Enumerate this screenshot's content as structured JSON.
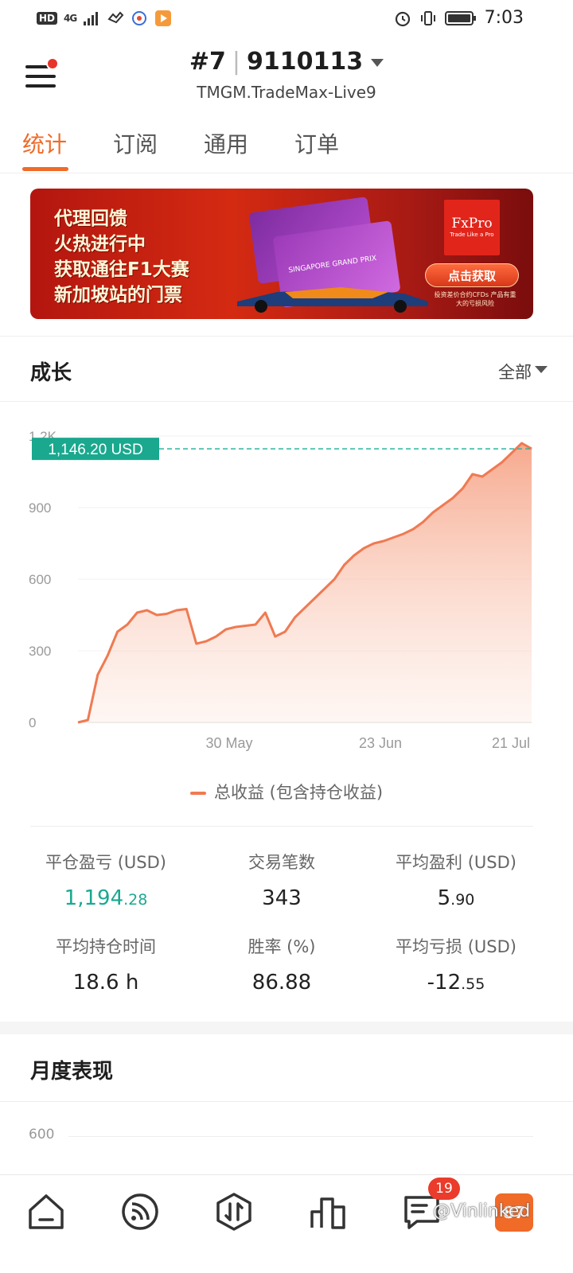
{
  "status_bar": {
    "hd": "HD",
    "signal": "4G",
    "time": "7:03"
  },
  "header": {
    "account_prefix": "#7",
    "account_number": "9110113",
    "server": "TMGM.TradeMax-Live9"
  },
  "tabs": [
    {
      "label": "统计",
      "active": true
    },
    {
      "label": "订阅",
      "active": false
    },
    {
      "label": "通用",
      "active": false
    },
    {
      "label": "订单",
      "active": false
    }
  ],
  "banner": {
    "lines": [
      "代理回馈",
      "火热进行中",
      "获取通往F1大赛",
      "新加坡站的门票"
    ],
    "brand": "FxPro",
    "brand_tagline": "Trade Like a Pro",
    "card_text": "SINGAPORE GRAND PRIX",
    "button": "点击获取",
    "risk_note": "投资差价合约CFDs 产品有重大的亏损风险"
  },
  "growth": {
    "title": "成长",
    "filter": "全部",
    "current_value_label": "1,146.20 USD",
    "legend": "总收益 (包含持仓收益)"
  },
  "chart_data": {
    "type": "area",
    "y_ticks": [
      "0",
      "300",
      "600",
      "900",
      "1.2K"
    ],
    "x_ticks": [
      "30 May",
      "23 Jun",
      "21 Jul"
    ],
    "ylim": [
      0,
      1200
    ],
    "current_value": 1146.2,
    "grid": true,
    "series": [
      {
        "values": [
          0,
          10,
          200,
          280,
          380,
          410,
          460,
          470,
          450,
          455,
          470,
          475,
          330,
          340,
          360,
          390,
          400,
          405,
          410,
          460,
          360,
          380,
          440,
          480,
          520,
          560,
          600,
          660,
          700,
          730,
          750,
          760,
          775,
          790,
          810,
          840,
          880,
          910,
          940,
          980,
          1040,
          1030,
          1060,
          1090,
          1130,
          1170,
          1146.2
        ]
      }
    ]
  },
  "stats": [
    {
      "label": "平仓盈亏 (USD)",
      "int": "1,194",
      "dec": ".28",
      "green": true
    },
    {
      "label": "交易笔数",
      "int": "343",
      "dec": "",
      "green": false
    },
    {
      "label": "平均盈利 (USD)",
      "int": "5",
      "dec": ".90",
      "green": false
    },
    {
      "label": "平均持仓时间",
      "int": "18.6 h",
      "dec": "",
      "green": false
    },
    {
      "label": "胜率 (%)",
      "int": "86.88",
      "dec": "",
      "green": false
    },
    {
      "label": "平均亏损 (USD)",
      "int": "-12",
      "dec": ".55",
      "green": false
    }
  ],
  "monthly": {
    "title": "月度表现",
    "first_tick": "600"
  },
  "bottom_nav": {
    "items": [
      "home-icon",
      "feed-icon",
      "trade-icon",
      "ranking-icon",
      "messages-icon",
      "profile"
    ],
    "badge": "19",
    "profile_text": "87"
  },
  "watermark": "@Vinlinked",
  "colors": {
    "accent": "#f06a28",
    "positive": "#1ba892",
    "chart_line": "#ef7a52"
  }
}
